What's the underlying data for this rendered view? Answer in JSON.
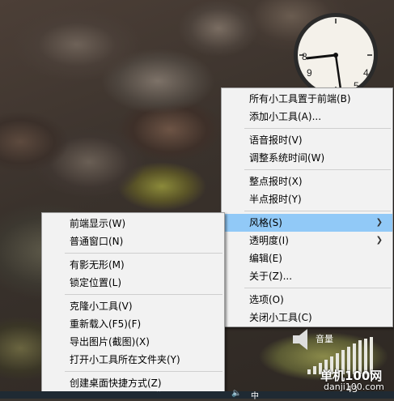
{
  "main_menu": {
    "items": [
      {
        "label": "所有小工具置于前端(B)"
      },
      {
        "label": "添加小工具(A)..."
      },
      {
        "label": "语音报时(V)"
      },
      {
        "label": "调整系统时间(W)"
      },
      {
        "label": "整点报时(X)"
      },
      {
        "label": "半点报时(Y)"
      },
      {
        "label": "风格(S)",
        "submenu": true,
        "highlighted": true
      },
      {
        "label": "透明度(I)",
        "submenu": true
      },
      {
        "label": "编辑(E)"
      },
      {
        "label": "关于(Z)..."
      },
      {
        "label": "选项(O)"
      },
      {
        "label": "关闭小工具(C)"
      }
    ]
  },
  "sub_menu": {
    "items": [
      {
        "label": "前端显示(W)"
      },
      {
        "label": "普通窗口(N)"
      },
      {
        "label": "有影无形(M)"
      },
      {
        "label": "锁定位置(L)"
      },
      {
        "label": "克隆小工具(V)"
      },
      {
        "label": "重新载入(F5)(F)"
      },
      {
        "label": "导出图片(截图)(X)"
      },
      {
        "label": "打开小工具所在文件夹(Y)"
      },
      {
        "label": "创建桌面快捷方式(Z)"
      }
    ]
  },
  "clock": {
    "numbers": [
      "8",
      "9",
      "4",
      "5"
    ]
  },
  "volume": {
    "label": "音量",
    "value": "43"
  },
  "taskbar": {
    "ime": "中"
  },
  "watermark": {
    "main": "单机100网",
    "sub": "danji100.com"
  },
  "colors": {
    "menu_bg": "#f2f2f2",
    "highlight": "#91c9f7"
  }
}
